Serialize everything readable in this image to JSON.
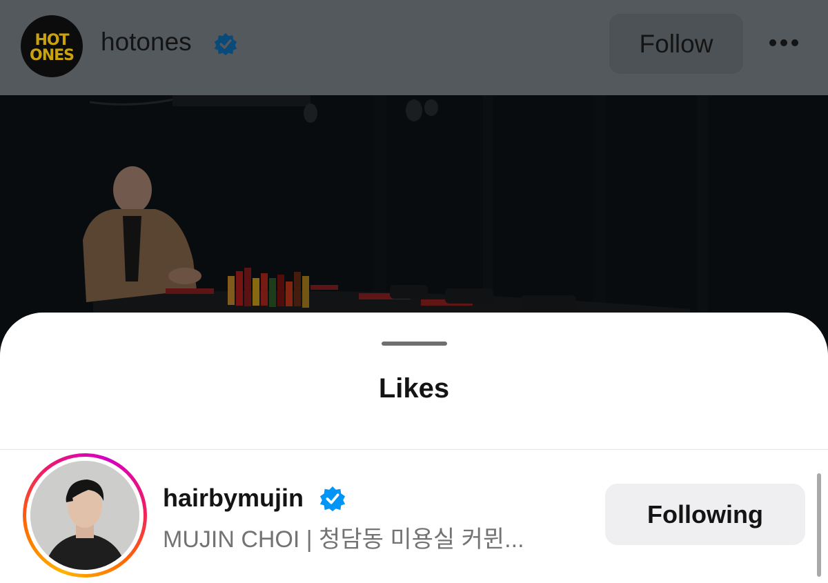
{
  "post_header": {
    "logo_text_line1": "HOT",
    "logo_text_line2": "ONES",
    "username": "hotones",
    "verified": true,
    "follow_label": "Follow",
    "more_icon": "more-horizontal-icon"
  },
  "video": {
    "description": "host seated at table with row of hot sauce bottles"
  },
  "likes_sheet": {
    "title": "Likes",
    "items": [
      {
        "username": "hairbymujin",
        "verified": true,
        "subtitle": "MUJIN CHOI | 청담동 미용실 커뮌...",
        "button_label": "Following",
        "has_story": true
      }
    ]
  },
  "colors": {
    "verified_blue": "#0095f6",
    "header_dim": "#54595e",
    "sheet_bg": "#ffffff",
    "following_btn_bg": "#efeff2"
  }
}
